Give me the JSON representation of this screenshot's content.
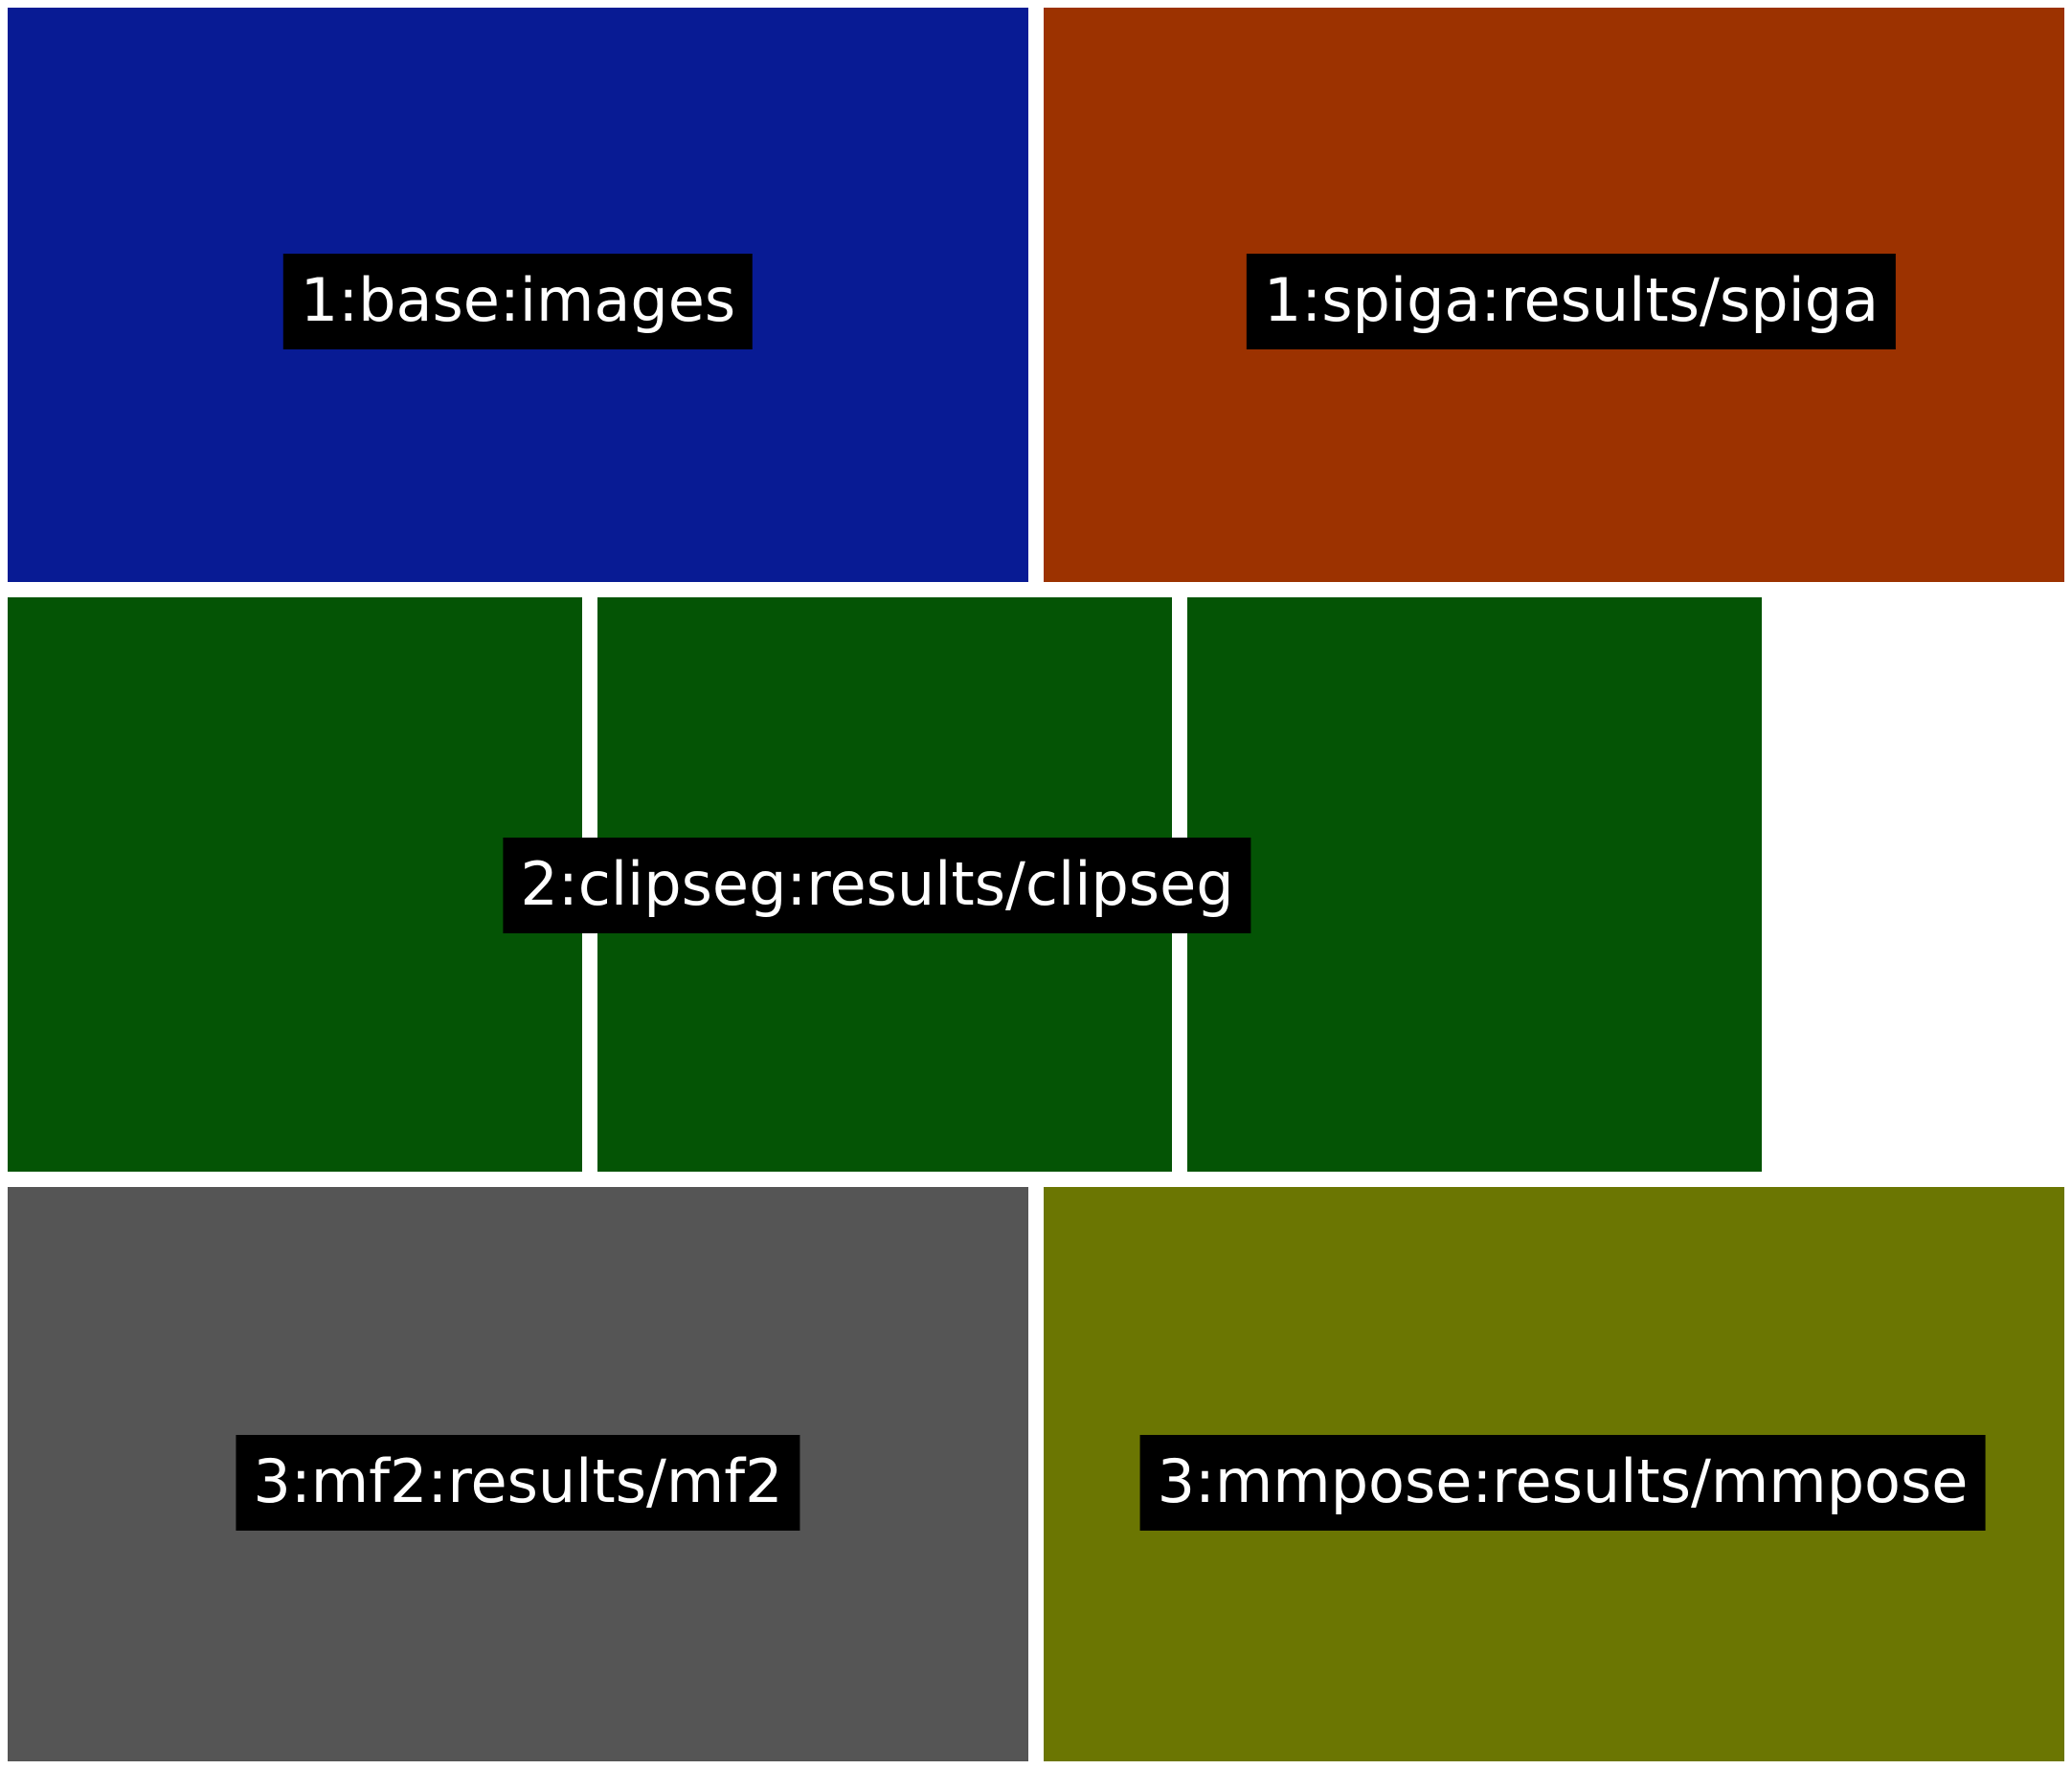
{
  "colors": {
    "background": "#ffffff",
    "label_background": "#000000",
    "label_text": "#ffffff",
    "base": "#081b94",
    "spiga": "#9c3200",
    "clipseg": "#045405",
    "mf2": "#555555",
    "mmpose": "#6b7602"
  },
  "rows": [
    {
      "panels": [
        {
          "name": "base-panel",
          "color_key": "base"
        },
        {
          "name": "spiga-panel",
          "color_key": "spiga"
        }
      ],
      "labels": [
        {
          "name": "base-label",
          "text": "1:base:images"
        },
        {
          "name": "spiga-label",
          "text": "1:spiga:results/spiga"
        }
      ]
    },
    {
      "panels": [
        {
          "name": "clipseg-panel-1",
          "color_key": "clipseg"
        },
        {
          "name": "clipseg-panel-2",
          "color_key": "clipseg"
        },
        {
          "name": "clipseg-panel-3",
          "color_key": "clipseg"
        }
      ],
      "labels": [
        {
          "name": "clipseg-label",
          "text": "2:clipseg:results/clipseg"
        }
      ]
    },
    {
      "panels": [
        {
          "name": "mf2-panel",
          "color_key": "mf2"
        },
        {
          "name": "mmpose-panel",
          "color_key": "mmpose"
        }
      ],
      "labels": [
        {
          "name": "mf2-label",
          "text": "3:mf2:results/mf2"
        },
        {
          "name": "mmpose-label",
          "text": "3:mmpose:results/mmpose"
        }
      ]
    }
  ]
}
